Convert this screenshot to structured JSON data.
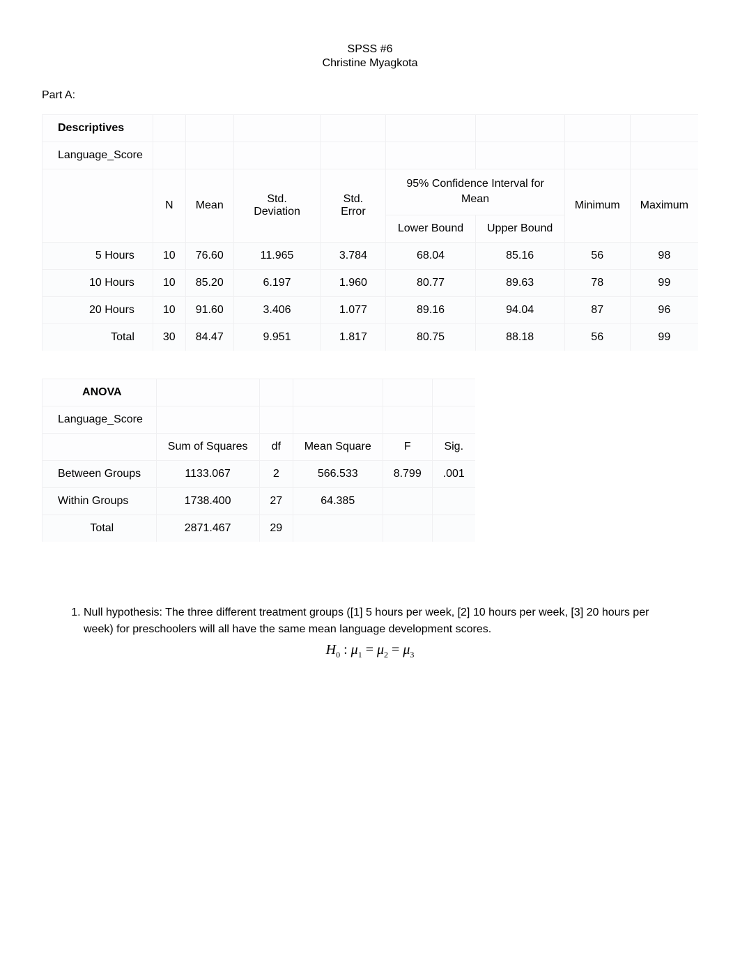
{
  "header": {
    "line1": "SPSS #6",
    "line2": "Christine Myagkota"
  },
  "part_label": "Part A:",
  "descriptives": {
    "title": "Descriptives",
    "subtitle": "Language_Score",
    "ci_header": "95% Confidence Interval for Mean",
    "cols": {
      "n": "N",
      "mean": "Mean",
      "std_dev": "Std. Deviation",
      "std_err": "Std. Error",
      "lower": "Lower Bound",
      "upper": "Upper Bound",
      "min": "Minimum",
      "max": "Maximum"
    },
    "rows": [
      {
        "label": "5 Hours",
        "n": "10",
        "mean": "76.60",
        "sd": "11.965",
        "se": "3.784",
        "lb": "68.04",
        "ub": "85.16",
        "min": "56",
        "max": "98"
      },
      {
        "label": "10 Hours",
        "n": "10",
        "mean": "85.20",
        "sd": "6.197",
        "se": "1.960",
        "lb": "80.77",
        "ub": "89.63",
        "min": "78",
        "max": "99"
      },
      {
        "label": "20 Hours",
        "n": "10",
        "mean": "91.60",
        "sd": "3.406",
        "se": "1.077",
        "lb": "89.16",
        "ub": "94.04",
        "min": "87",
        "max": "96"
      },
      {
        "label": "Total",
        "n": "30",
        "mean": "84.47",
        "sd": "9.951",
        "se": "1.817",
        "lb": "80.75",
        "ub": "88.18",
        "min": "56",
        "max": "99"
      }
    ]
  },
  "anova": {
    "title": "ANOVA",
    "subtitle": "Language_Score",
    "cols": {
      "ss": "Sum of Squares",
      "df": "df",
      "ms": "Mean Square",
      "f": "F",
      "sig": "Sig."
    },
    "rows": [
      {
        "label": "Between Groups",
        "ss": "1133.067",
        "df": "2",
        "ms": "566.533",
        "f": "8.799",
        "sig": ".001"
      },
      {
        "label": "Within Groups",
        "ss": "1738.400",
        "df": "27",
        "ms": "64.385",
        "f": "",
        "sig": ""
      },
      {
        "label": "Total",
        "ss": "2871.467",
        "df": "29",
        "ms": "",
        "f": "",
        "sig": ""
      }
    ]
  },
  "notes": {
    "item1": "Null hypothesis: The three different treatment groups ([1] 5 hours per week, [2] 10 hours per week, [3] 20 hours per week) for preschoolers will all have the same mean language development scores.",
    "equation": {
      "H": "H",
      "zero": "0",
      "colon": ":",
      "mu": "μ",
      "s1": "1",
      "eq": "=",
      "s2": "2",
      "s3": "3"
    }
  }
}
